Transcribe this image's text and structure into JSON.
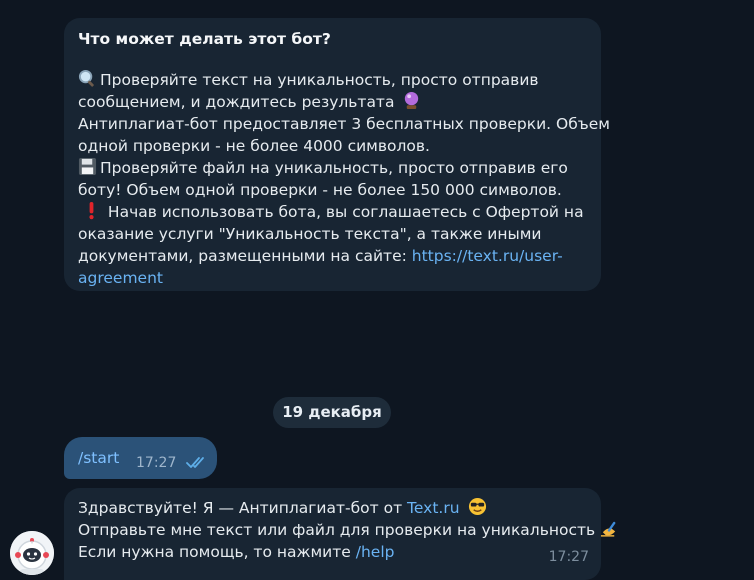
{
  "bot_info": {
    "title": "Что может делать этот бот?",
    "lines": [
      "Проверяйте текст на уникальность, просто отправив",
      "сообщением, и дождитесь результата",
      "Антиплагиат-бот предоставляет 3 бесплатных проверки. Объем",
      "одной проверки - не более 4000 символов.",
      "Проверяйте файл на уникальность, просто отправив его",
      "боту! Объем одной проверки - не более 150 000 символов.",
      " Начав использовать бота, вы соглашаетесь с Офертой на",
      "оказание услуги \"Уникальность текста\", а также иными",
      "документами, размещенными на сайте: ",
      "agreement"
    ],
    "link_part1": "https://text.ru/user-",
    "emoji": {
      "line1": "magnifier-icon",
      "line2": "crystal-ball-icon",
      "line5": "floppy-disk-icon",
      "line7": "exclamation-icon"
    }
  },
  "date_separator": "19 декабря",
  "outgoing": {
    "text": "/start",
    "time": "17:27",
    "status_icon": "double-check-icon"
  },
  "incoming": {
    "line1_prefix": "Здравствуйте! Я — Антиплагиат-бот от ",
    "line1_link": "Text.ru",
    "line2": "Отправьте мне текст или файл для проверки на уникальность ",
    "line3_prefix": "Если нужна помощь, то нажмите ",
    "line3_link": "/help",
    "time": "17:27",
    "emoji": {
      "line1": "sunglasses-icon",
      "line2": "writing-hand-icon"
    }
  },
  "colors": {
    "background": "#0e1621",
    "incoming_bubble": "#182533",
    "outgoing_bubble": "#2b5278",
    "link": "#6ab3f3"
  }
}
